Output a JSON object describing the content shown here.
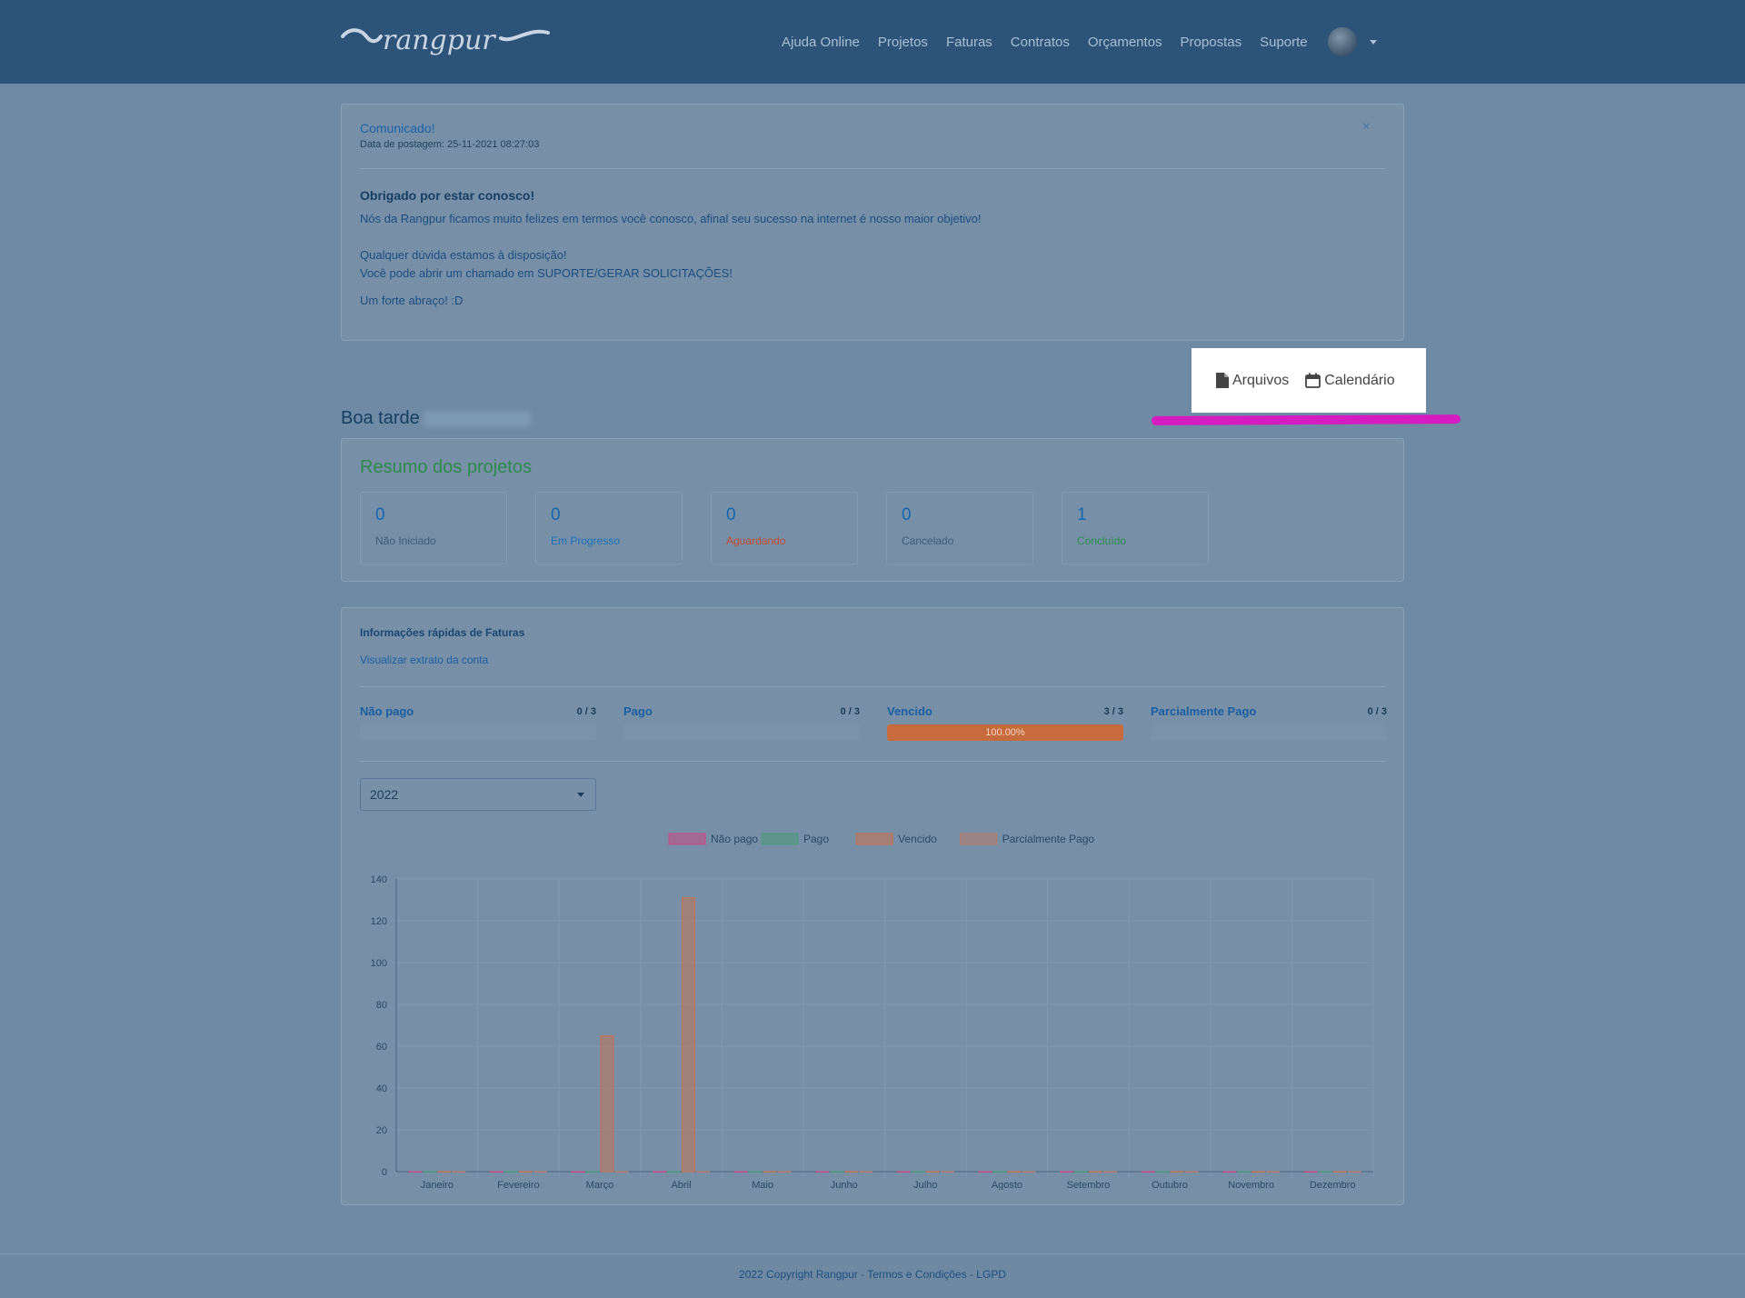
{
  "brand": {
    "logo_text": "rangpur"
  },
  "nav": {
    "items": [
      "Ajuda Online",
      "Projetos",
      "Faturas",
      "Contratos",
      "Orçamentos",
      "Propostas",
      "Suporte"
    ]
  },
  "announcement": {
    "title": "Comunicado!",
    "date": "Data de postagem: 25-11-2021 08:27:03",
    "close": "×",
    "heading": "Obrigado por estar conosco!",
    "line1": "Nós da Rangpur ficamos muito felizes em termos você conosco, afinal seu sucesso na internet é nosso maior objetivo!",
    "line2": "Qualquer dúvida estamos à disposição!",
    "line3": "Você pode abrir um chamado em SUPORTE/GERAR SOLICITAÇÕES!",
    "line4": "Um forte abraço! :D"
  },
  "shortcuts": {
    "files": "Arquivos",
    "calendar": "Calendário"
  },
  "highlight_color": "#d51cc1",
  "greeting": "Boa tarde",
  "projects": {
    "title": "Resumo dos projetos",
    "stats": [
      {
        "value": "0",
        "label": "Não Iniciado",
        "color": "#3f5a74"
      },
      {
        "value": "0",
        "label": "Em Progresso",
        "color": "#1b6fb8"
      },
      {
        "value": "0",
        "label": "Aguardando",
        "color": "#c04a2e"
      },
      {
        "value": "0",
        "label": "Cancelado",
        "color": "#3f5a74"
      },
      {
        "value": "1",
        "label": "Concluído",
        "color": "#2e8a4c"
      }
    ]
  },
  "invoices": {
    "title": "Informações rápidas de Faturas",
    "link": "Visualizar extrato da conta",
    "stats": [
      {
        "name": "Não pago",
        "count": "0 / 3",
        "percent": 0,
        "label": ""
      },
      {
        "name": "Pago",
        "count": "0 / 3",
        "percent": 0,
        "label": ""
      },
      {
        "name": "Vencido",
        "count": "3 / 3",
        "percent": 100,
        "label": "100.00%"
      },
      {
        "name": "Parcialmente Pago",
        "count": "0 / 3",
        "percent": 0,
        "label": ""
      }
    ],
    "year": "2022"
  },
  "chart_data": {
    "type": "bar",
    "categories": [
      "Janeiro",
      "Fevereiro",
      "Março",
      "Abril",
      "Maio",
      "Junho",
      "Julho",
      "Agosto",
      "Setembro",
      "Outubro",
      "Novembro",
      "Dezembro"
    ],
    "series": [
      {
        "name": "Não pago",
        "color": "#c94a86",
        "values": [
          0,
          0,
          0,
          0,
          0,
          0,
          0,
          0,
          0,
          0,
          0,
          0
        ]
      },
      {
        "name": "Pago",
        "color": "#4a9a7a",
        "values": [
          0,
          0,
          0,
          0,
          0,
          0,
          0,
          0,
          0,
          0,
          0,
          0
        ]
      },
      {
        "name": "Vencido",
        "color": "#c8714e",
        "values": [
          0,
          0,
          65,
          131,
          0,
          0,
          0,
          0,
          0,
          0,
          0,
          0
        ]
      },
      {
        "name": "Parcialmente Pago",
        "color": "#b87a66",
        "values": [
          0,
          0,
          0,
          0,
          0,
          0,
          0,
          0,
          0,
          0,
          0,
          0
        ]
      }
    ],
    "ylim": [
      0,
      140
    ],
    "yticks": [
      0,
      20,
      40,
      60,
      80,
      100,
      120,
      140
    ],
    "legend": "top",
    "grid": true
  },
  "footer": {
    "copyright": "2022 Copyright Rangpur - ",
    "terms": "Termos e Condições",
    "sep": " - ",
    "lgpd": "LGPD"
  }
}
